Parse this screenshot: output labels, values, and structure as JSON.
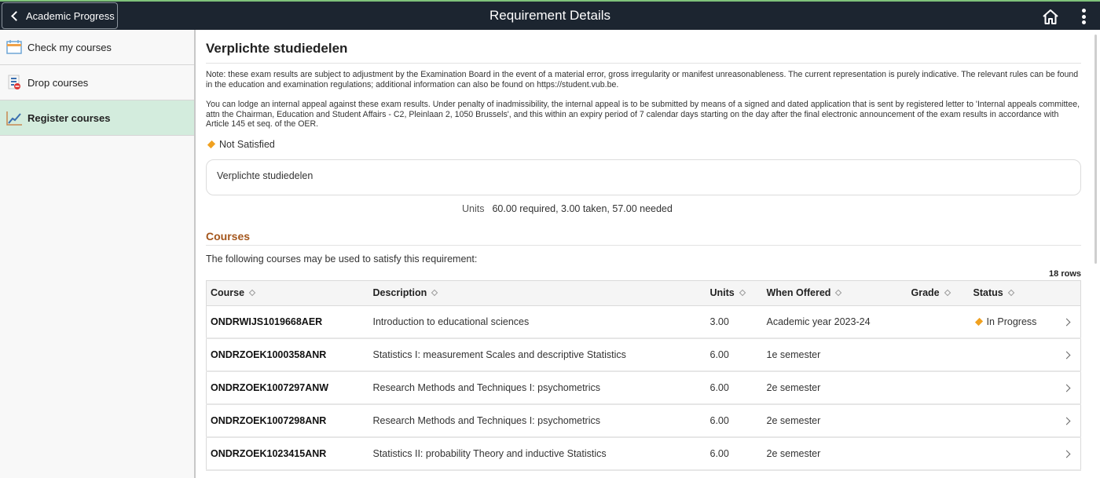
{
  "header": {
    "back_label": "Academic Progress",
    "title": "Requirement Details",
    "home_icon": "home-icon",
    "more_icon": "more-vertical-icon"
  },
  "sidebar": {
    "items": [
      {
        "label": "Check my courses",
        "icon": "calendar-icon",
        "active": false
      },
      {
        "label": "Drop courses",
        "icon": "drop-list-icon",
        "active": false
      },
      {
        "label": "Register courses",
        "icon": "chart-line-icon",
        "active": true
      }
    ]
  },
  "main": {
    "title": "Verplichte studiedelen",
    "note1": "Note: these exam results are subject to adjustment by the Examination Board in the event of a material error, gross irregularity or manifest unreasonableness. The current representation is purely indicative. The relevant rules can be found in the education and examination regulations; additional information can also be found on https://student.vub.be.",
    "note2": "You can lodge an internal appeal against these exam results. Under penalty of inadmissibility, the internal appeal is to be submitted by means of a signed and dated application that is sent by registered letter to 'Internal appeals committee, attn the Chairman, Education and Student Affairs - C2, Pleinlaan 2, 1050 Brussels', and this within an expiry period of 7 calendar days starting on the day after the final electronic announcement of the exam results in accordance with Article 145 et seq. of the OER.",
    "status": "Not Satisfied",
    "status_color": "#f0a120",
    "requirement_box": "Verplichte studiedelen",
    "units_label": "Units",
    "units_value": "60.00 required, 3.00 taken, 57.00 needed",
    "courses_title": "Courses",
    "courses_intro": "The following courses may be used to satisfy this requirement:",
    "row_count": "18 rows",
    "accent_color": "#a4561c"
  },
  "table": {
    "columns": [
      "Course",
      "Description",
      "Units",
      "When Offered",
      "Grade",
      "Status"
    ],
    "rows": [
      {
        "course": "ONDRWIJS1019668AER",
        "description": "Introduction to educational sciences",
        "units": "3.00",
        "when": "Academic year 2023-24",
        "grade": "",
        "status": "In Progress"
      },
      {
        "course": "ONDRZOEK1000358ANR",
        "description": "Statistics I: measurement Scales and descriptive Statistics",
        "units": "6.00",
        "when": "1e semester",
        "grade": "",
        "status": ""
      },
      {
        "course": "ONDRZOEK1007297ANW",
        "description": "Research Methods and Techniques I: psychometrics",
        "units": "6.00",
        "when": "2e semester",
        "grade": "",
        "status": ""
      },
      {
        "course": "ONDRZOEK1007298ANR",
        "description": "Research Methods and Techniques I: psychometrics",
        "units": "6.00",
        "when": "2e semester",
        "grade": "",
        "status": ""
      },
      {
        "course": "ONDRZOEK1023415ANR",
        "description": "Statistics II: probability Theory and inductive Statistics",
        "units": "6.00",
        "when": "2e semester",
        "grade": "",
        "status": ""
      }
    ]
  }
}
